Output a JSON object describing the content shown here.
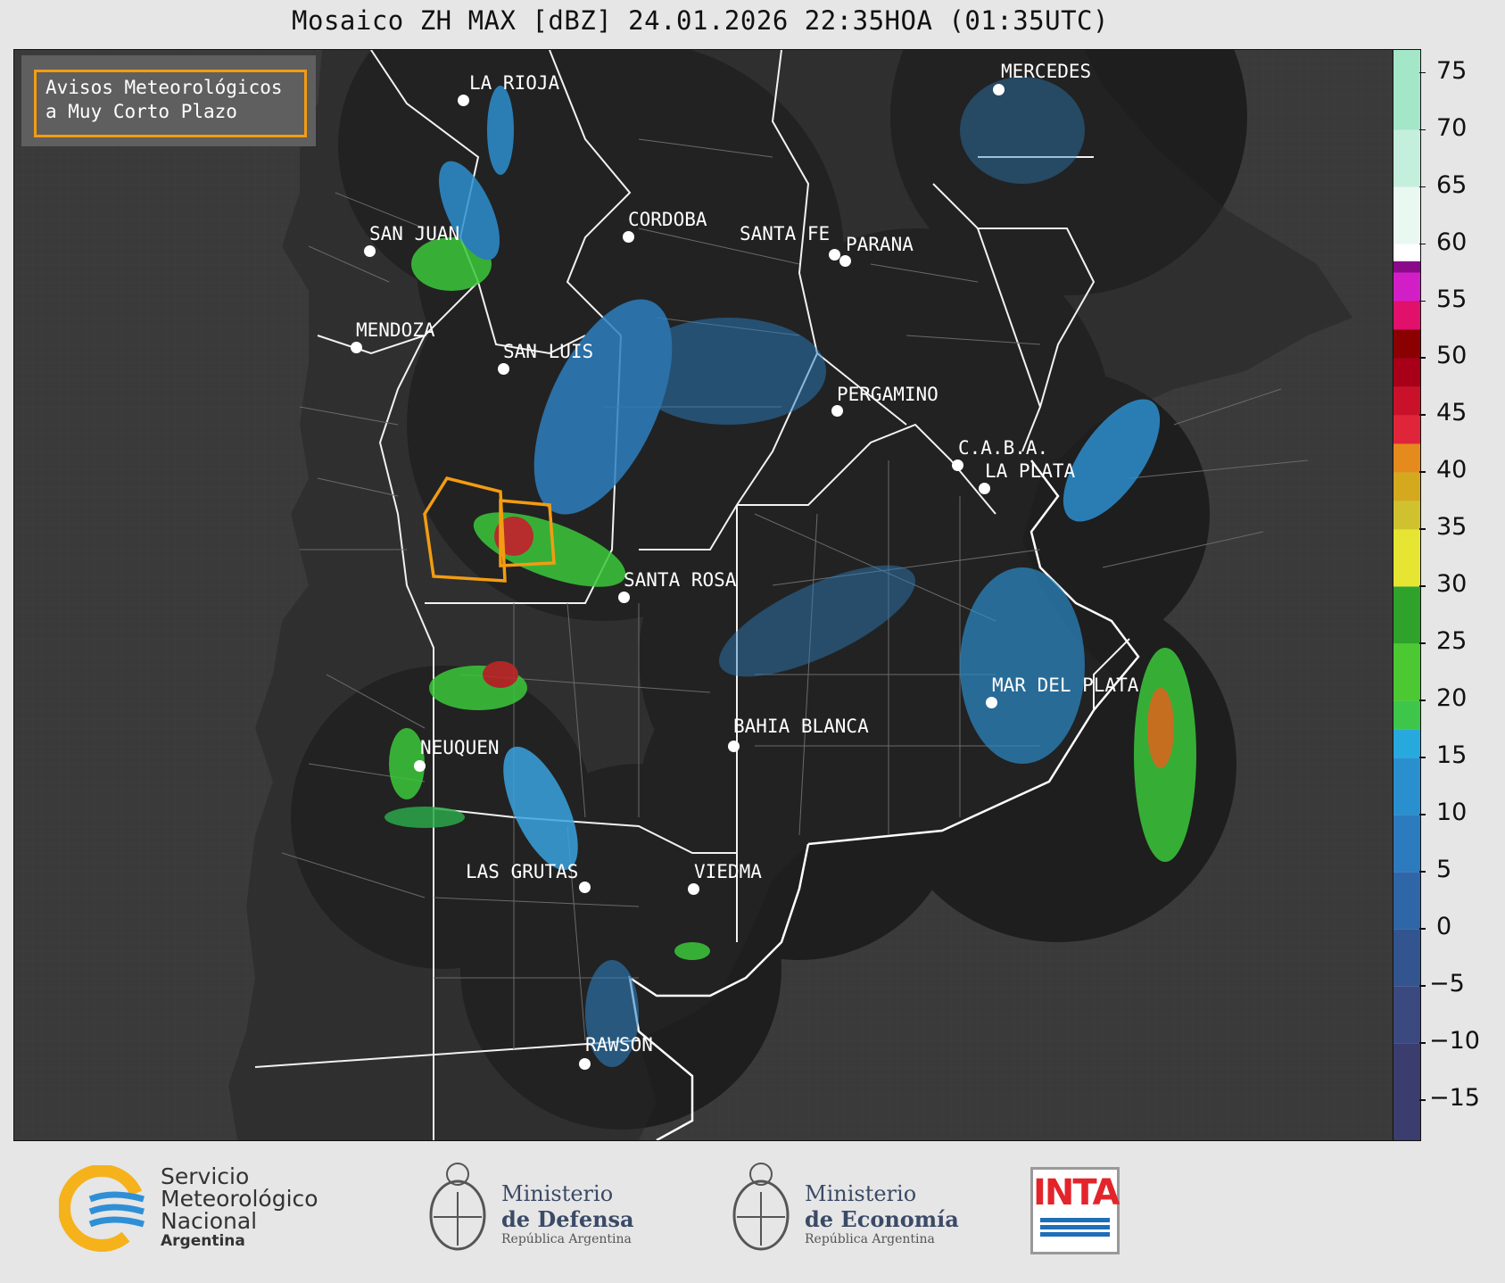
{
  "title": "Mosaico ZH MAX [dBZ] 24.01.2026 22:35HOA (01:35UTC)",
  "legend": {
    "line1": "Avisos Meteorológicos",
    "line2": "a Muy Corto Plazo",
    "border_color": "#f39c12"
  },
  "cities": [
    {
      "name": "LA RIOJA"
    },
    {
      "name": "MERCEDES"
    },
    {
      "name": "SAN JUAN"
    },
    {
      "name": "CORDOBA"
    },
    {
      "name": "SANTA FE"
    },
    {
      "name": "PARANA"
    },
    {
      "name": "MENDOZA"
    },
    {
      "name": "SAN LUIS"
    },
    {
      "name": "PERGAMINO"
    },
    {
      "name": "C.A.B.A."
    },
    {
      "name": "LA PLATA"
    },
    {
      "name": "SANTA ROSA"
    },
    {
      "name": "MAR DEL PLATA"
    },
    {
      "name": "BAHIA BLANCA"
    },
    {
      "name": "NEUQUEN"
    },
    {
      "name": "LAS GRUTAS"
    },
    {
      "name": "VIEDMA"
    },
    {
      "name": "RAWSON"
    }
  ],
  "colorbar": {
    "unit": "dBZ",
    "ticks": [
      "75",
      "70",
      "65",
      "60",
      "55",
      "50",
      "45",
      "40",
      "35",
      "30",
      "25",
      "20",
      "15",
      "10",
      "5",
      "0",
      "−5",
      "−10",
      "−15"
    ],
    "min": -18.5,
    "max": 77
  },
  "footer": {
    "smn": {
      "l1": "Servicio",
      "l2": "Meteorológico",
      "l3": "Nacional",
      "l4": "Argentina"
    },
    "defensa": {
      "l1": "Ministerio",
      "l2": "de Defensa",
      "l3": "República Argentina"
    },
    "economia": {
      "l1": "Ministerio",
      "l2": "de Economía",
      "l3": "República Argentina"
    },
    "inta": "INTA"
  }
}
